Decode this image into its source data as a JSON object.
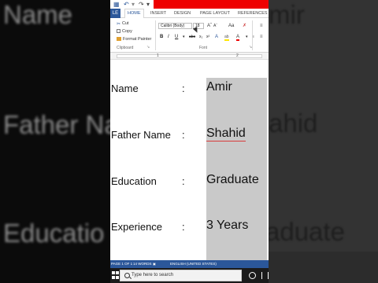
{
  "app": {
    "tabs": {
      "file": "LE",
      "home": "HOME",
      "insert": "INSERT",
      "design": "DESIGN",
      "page_layout": "PAGE LAYOUT",
      "references": "REFERENCES"
    },
    "accent_color": "#2b579a"
  },
  "ribbon": {
    "clipboard": {
      "cut": "Cut",
      "copy": "Copy",
      "format_painter": "Format Painter",
      "group_label": "Clipboard"
    },
    "font": {
      "family": "Calibri (Body)",
      "size": "18",
      "group_label": "Font",
      "case_label": "Aa"
    }
  },
  "ruler": {
    "marks": [
      "1",
      "2"
    ]
  },
  "document": {
    "rows": [
      {
        "label": "Name",
        "colon": ":",
        "value": "Amir"
      },
      {
        "label": "Father Name",
        "colon": ":",
        "value": "Shahid"
      },
      {
        "label": "Education",
        "colon": ":",
        "value": "Graduate"
      },
      {
        "label": "Experience",
        "colon": ":",
        "value": "3 Years"
      }
    ],
    "highlight_color": "#c9c9c9"
  },
  "statusbar": {
    "page": "PAGE 1 OF 1",
    "words": "14 WORDS",
    "language": "ENGLISH (UNITED STATES)"
  },
  "taskbar": {
    "search_placeholder": "Type here to search"
  },
  "background": {
    "left_texts": [
      "Name",
      "Father Na",
      "Educatio"
    ],
    "right_texts": [
      "mir",
      "ahid",
      "aduate"
    ]
  }
}
